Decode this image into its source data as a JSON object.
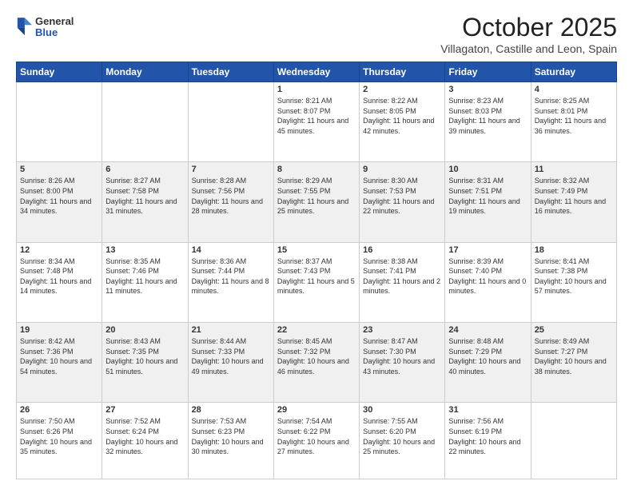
{
  "header": {
    "logo_general": "General",
    "logo_blue": "Blue",
    "month_title": "October 2025",
    "location": "Villagaton, Castille and Leon, Spain"
  },
  "days_of_week": [
    "Sunday",
    "Monday",
    "Tuesday",
    "Wednesday",
    "Thursday",
    "Friday",
    "Saturday"
  ],
  "weeks": [
    [
      {
        "num": "",
        "info": ""
      },
      {
        "num": "",
        "info": ""
      },
      {
        "num": "",
        "info": ""
      },
      {
        "num": "1",
        "info": "Sunrise: 8:21 AM\nSunset: 8:07 PM\nDaylight: 11 hours\nand 45 minutes."
      },
      {
        "num": "2",
        "info": "Sunrise: 8:22 AM\nSunset: 8:05 PM\nDaylight: 11 hours\nand 42 minutes."
      },
      {
        "num": "3",
        "info": "Sunrise: 8:23 AM\nSunset: 8:03 PM\nDaylight: 11 hours\nand 39 minutes."
      },
      {
        "num": "4",
        "info": "Sunrise: 8:25 AM\nSunset: 8:01 PM\nDaylight: 11 hours\nand 36 minutes."
      }
    ],
    [
      {
        "num": "5",
        "info": "Sunrise: 8:26 AM\nSunset: 8:00 PM\nDaylight: 11 hours\nand 34 minutes."
      },
      {
        "num": "6",
        "info": "Sunrise: 8:27 AM\nSunset: 7:58 PM\nDaylight: 11 hours\nand 31 minutes."
      },
      {
        "num": "7",
        "info": "Sunrise: 8:28 AM\nSunset: 7:56 PM\nDaylight: 11 hours\nand 28 minutes."
      },
      {
        "num": "8",
        "info": "Sunrise: 8:29 AM\nSunset: 7:55 PM\nDaylight: 11 hours\nand 25 minutes."
      },
      {
        "num": "9",
        "info": "Sunrise: 8:30 AM\nSunset: 7:53 PM\nDaylight: 11 hours\nand 22 minutes."
      },
      {
        "num": "10",
        "info": "Sunrise: 8:31 AM\nSunset: 7:51 PM\nDaylight: 11 hours\nand 19 minutes."
      },
      {
        "num": "11",
        "info": "Sunrise: 8:32 AM\nSunset: 7:49 PM\nDaylight: 11 hours\nand 16 minutes."
      }
    ],
    [
      {
        "num": "12",
        "info": "Sunrise: 8:34 AM\nSunset: 7:48 PM\nDaylight: 11 hours\nand 14 minutes."
      },
      {
        "num": "13",
        "info": "Sunrise: 8:35 AM\nSunset: 7:46 PM\nDaylight: 11 hours\nand 11 minutes."
      },
      {
        "num": "14",
        "info": "Sunrise: 8:36 AM\nSunset: 7:44 PM\nDaylight: 11 hours\nand 8 minutes."
      },
      {
        "num": "15",
        "info": "Sunrise: 8:37 AM\nSunset: 7:43 PM\nDaylight: 11 hours\nand 5 minutes."
      },
      {
        "num": "16",
        "info": "Sunrise: 8:38 AM\nSunset: 7:41 PM\nDaylight: 11 hours\nand 2 minutes."
      },
      {
        "num": "17",
        "info": "Sunrise: 8:39 AM\nSunset: 7:40 PM\nDaylight: 11 hours\nand 0 minutes."
      },
      {
        "num": "18",
        "info": "Sunrise: 8:41 AM\nSunset: 7:38 PM\nDaylight: 10 hours\nand 57 minutes."
      }
    ],
    [
      {
        "num": "19",
        "info": "Sunrise: 8:42 AM\nSunset: 7:36 PM\nDaylight: 10 hours\nand 54 minutes."
      },
      {
        "num": "20",
        "info": "Sunrise: 8:43 AM\nSunset: 7:35 PM\nDaylight: 10 hours\nand 51 minutes."
      },
      {
        "num": "21",
        "info": "Sunrise: 8:44 AM\nSunset: 7:33 PM\nDaylight: 10 hours\nand 49 minutes."
      },
      {
        "num": "22",
        "info": "Sunrise: 8:45 AM\nSunset: 7:32 PM\nDaylight: 10 hours\nand 46 minutes."
      },
      {
        "num": "23",
        "info": "Sunrise: 8:47 AM\nSunset: 7:30 PM\nDaylight: 10 hours\nand 43 minutes."
      },
      {
        "num": "24",
        "info": "Sunrise: 8:48 AM\nSunset: 7:29 PM\nDaylight: 10 hours\nand 40 minutes."
      },
      {
        "num": "25",
        "info": "Sunrise: 8:49 AM\nSunset: 7:27 PM\nDaylight: 10 hours\nand 38 minutes."
      }
    ],
    [
      {
        "num": "26",
        "info": "Sunrise: 7:50 AM\nSunset: 6:26 PM\nDaylight: 10 hours\nand 35 minutes."
      },
      {
        "num": "27",
        "info": "Sunrise: 7:52 AM\nSunset: 6:24 PM\nDaylight: 10 hours\nand 32 minutes."
      },
      {
        "num": "28",
        "info": "Sunrise: 7:53 AM\nSunset: 6:23 PM\nDaylight: 10 hours\nand 30 minutes."
      },
      {
        "num": "29",
        "info": "Sunrise: 7:54 AM\nSunset: 6:22 PM\nDaylight: 10 hours\nand 27 minutes."
      },
      {
        "num": "30",
        "info": "Sunrise: 7:55 AM\nSunset: 6:20 PM\nDaylight: 10 hours\nand 25 minutes."
      },
      {
        "num": "31",
        "info": "Sunrise: 7:56 AM\nSunset: 6:19 PM\nDaylight: 10 hours\nand 22 minutes."
      },
      {
        "num": "",
        "info": ""
      }
    ]
  ]
}
